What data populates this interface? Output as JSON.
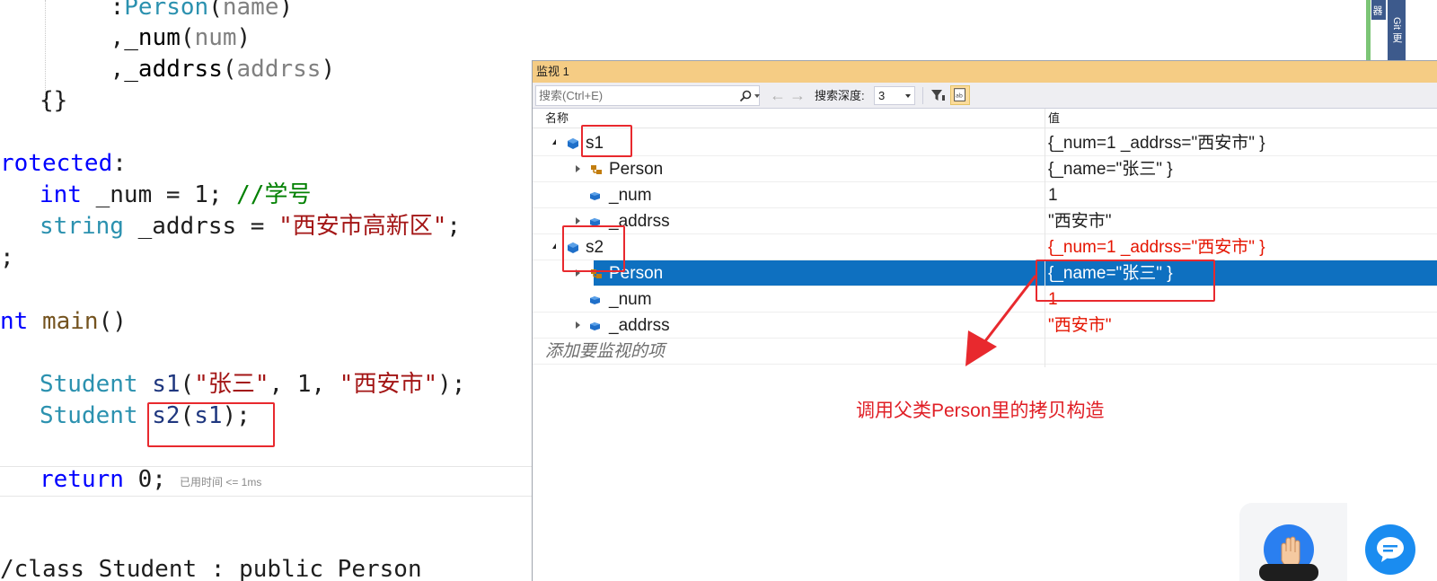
{
  "editor": {
    "lines": [
      {
        "parts": [
          {
            "t": "    ",
            "c": ""
          },
          {
            "t": ":",
            "c": ""
          },
          {
            "t": "Person",
            "c": "ty"
          },
          {
            "t": "(",
            "c": ""
          },
          {
            "t": "name",
            "c": "pm"
          },
          {
            "t": ")",
            "c": ""
          }
        ]
      },
      {
        "parts": [
          {
            "t": "    ,",
            "c": ""
          },
          {
            "t": "_num",
            "c": "fld"
          },
          {
            "t": "(",
            "c": ""
          },
          {
            "t": "num",
            "c": "pm"
          },
          {
            "t": ")",
            "c": ""
          }
        ]
      },
      {
        "parts": [
          {
            "t": "    ,",
            "c": ""
          },
          {
            "t": "_addrss",
            "c": "fld"
          },
          {
            "t": "(",
            "c": ""
          },
          {
            "t": "addrss",
            "c": "pm"
          },
          {
            "t": ")",
            "c": ""
          }
        ]
      },
      {
        "parts": [
          {
            "t": "{}",
            "c": ""
          }
        ]
      },
      {
        "parts": []
      },
      {
        "parts": [
          {
            "t": "rotected",
            "c": "kw"
          },
          {
            "t": ":",
            "c": ""
          }
        ]
      },
      {
        "parts": [
          {
            "t": "int",
            "c": "kw"
          },
          {
            "t": " _num = 1; ",
            "c": ""
          },
          {
            "t": "//学号",
            "c": "cm"
          }
        ]
      },
      {
        "parts": [
          {
            "t": "string",
            "c": "ty"
          },
          {
            "t": " _addrss = ",
            "c": ""
          },
          {
            "t": "\"西安市高新区\"",
            "c": "st"
          },
          {
            "t": ";",
            "c": ""
          }
        ]
      },
      {
        "parts": [
          {
            "t": ";",
            "c": ""
          }
        ]
      },
      {
        "parts": []
      },
      {
        "parts": [
          {
            "t": "nt",
            "c": "kw"
          },
          {
            "t": " ",
            "c": ""
          },
          {
            "t": "main",
            "c": "fn"
          },
          {
            "t": "()",
            "c": ""
          }
        ]
      },
      {
        "parts": []
      },
      {
        "parts": [
          {
            "t": "Student",
            "c": "ty"
          },
          {
            "t": " ",
            "c": ""
          },
          {
            "t": "s1",
            "c": "id"
          },
          {
            "t": "(",
            "c": ""
          },
          {
            "t": "\"张三\"",
            "c": "st"
          },
          {
            "t": ", 1, ",
            "c": ""
          },
          {
            "t": "\"西安市\"",
            "c": "st"
          },
          {
            "t": ");",
            "c": ""
          }
        ]
      },
      {
        "parts": [
          {
            "t": "Student",
            "c": "ty"
          },
          {
            "t": " ",
            "c": ""
          },
          {
            "t": "s2",
            "c": "id"
          },
          {
            "t": "(",
            "c": ""
          },
          {
            "t": "s1",
            "c": "id"
          },
          {
            "t": ");",
            "c": ""
          }
        ]
      },
      {
        "parts": []
      },
      {
        "parts": [
          {
            "t": "return",
            "c": "kw"
          },
          {
            "t": " 0;",
            "c": ""
          }
        ]
      },
      {
        "parts": []
      },
      {
        "parts": []
      },
      {
        "parts": [
          {
            "t": "/class Student : public Person",
            "c": ""
          }
        ]
      }
    ],
    "elapsed_hint": "已用时间 <= 1ms"
  },
  "watch": {
    "title": "监视 1",
    "search_placeholder": "搜索(Ctrl+E)",
    "depth_label": "搜索深度:",
    "depth_value": "3",
    "col_name": "名称",
    "col_value": "值",
    "rows": [
      {
        "name": "s1",
        "value": "{_num=1 _addrss=\"西安市\" }",
        "level": 0,
        "expander": "open",
        "icon": "object-icon",
        "changed": false
      },
      {
        "name": "Person",
        "value": "{_name=\"张三\" }",
        "level": 1,
        "expander": "closed",
        "icon": "base-class-icon",
        "changed": false
      },
      {
        "name": "_num",
        "value": "1",
        "level": 1,
        "expander": "none",
        "icon": "field-icon",
        "changed": false
      },
      {
        "name": "_addrss",
        "value": "\"西安市\"",
        "level": 1,
        "expander": "closed",
        "icon": "field-icon",
        "changed": false
      },
      {
        "name": "s2",
        "value": "{_num=1 _addrss=\"西安市\" }",
        "level": 0,
        "expander": "open",
        "icon": "object-icon",
        "changed": true
      },
      {
        "name": "Person",
        "value": "{_name=\"张三\" }",
        "level": 1,
        "expander": "closed",
        "icon": "base-class-icon",
        "changed": true,
        "selected": true
      },
      {
        "name": "_num",
        "value": "1",
        "level": 1,
        "expander": "none",
        "icon": "field-icon",
        "changed": true
      },
      {
        "name": "_addrss",
        "value": "\"西安市\"",
        "level": 1,
        "expander": "closed",
        "icon": "field-icon",
        "changed": true
      }
    ],
    "add_watch": "添加要监视的项",
    "annotation": "调用父类Person里的拷贝构造"
  },
  "side_tabs": [
    "器",
    "Git 更"
  ],
  "colors": {
    "title_bar": "#f5cc84",
    "selection": "#0e70c0",
    "changed_value": "#e51400",
    "annotation_red": "#e8292e"
  }
}
